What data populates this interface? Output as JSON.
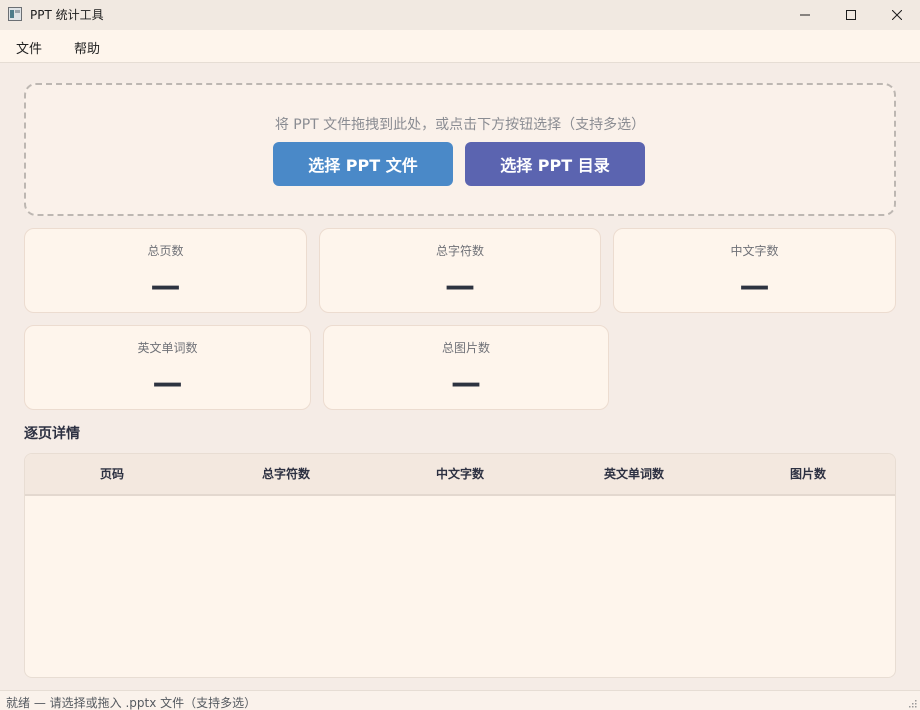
{
  "window": {
    "title": "PPT 统计工具",
    "icon": "app-icon"
  },
  "menu": {
    "file": "文件",
    "help": "帮助"
  },
  "dropzone": {
    "hint": "将 PPT 文件拖拽到此处，或点击下方按钮选择（支持多选）",
    "select_file_label": "选择 PPT 文件",
    "select_dir_label": "选择 PPT 目录",
    "file_button_color": "#4a89c8",
    "dir_button_color": "#5b64b0"
  },
  "stats": {
    "total_pages": {
      "label": "总页数",
      "value": "—"
    },
    "total_chars": {
      "label": "总字符数",
      "value": "—"
    },
    "chinese_chars": {
      "label": "中文字数",
      "value": "—"
    },
    "english_words": {
      "label": "英文单词数",
      "value": "—"
    },
    "total_images": {
      "label": "总图片数",
      "value": "—"
    }
  },
  "details": {
    "title": "逐页详情",
    "columns": [
      "页码",
      "总字符数",
      "中文字数",
      "英文单词数",
      "图片数"
    ],
    "rows": []
  },
  "status": {
    "text": "就绪 — 请选择或拖入 .pptx 文件（支持多选）"
  }
}
